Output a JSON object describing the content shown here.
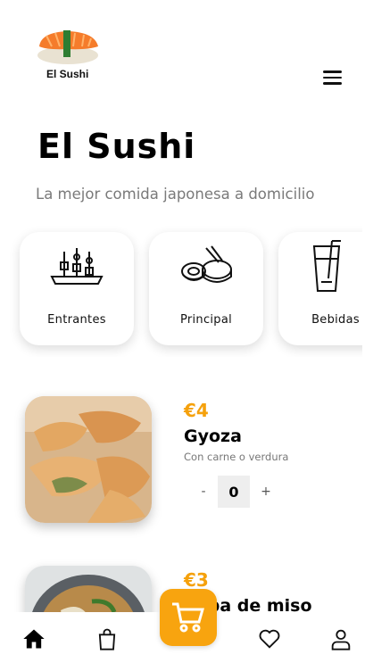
{
  "header": {
    "logo_text": "El Sushi",
    "menu_icon": "hamburger-icon"
  },
  "hero": {
    "title": "El Sushi",
    "subtitle": "La mejor comida japonesa a domicilio"
  },
  "categories": [
    {
      "label": "Entrantes",
      "icon": "skewers-icon"
    },
    {
      "label": "Principal",
      "icon": "sushi-roll-icon"
    },
    {
      "label": "Bebidas",
      "icon": "drink-glass-icon"
    }
  ],
  "products": [
    {
      "price": "€4",
      "name": "Gyoza",
      "description": "Con carne o verdura",
      "qty_minus": "-",
      "quantity": "0",
      "qty_plus": "+"
    },
    {
      "price": "€3",
      "name": "Sopa de miso"
    }
  ],
  "bottom_nav": {
    "items": [
      "home-icon",
      "bag-icon",
      "heart-icon",
      "user-icon"
    ],
    "cart_icon": "cart-icon"
  },
  "colors": {
    "accent": "#f8a40f",
    "text": "#111111",
    "muted": "#7a7a7a"
  }
}
